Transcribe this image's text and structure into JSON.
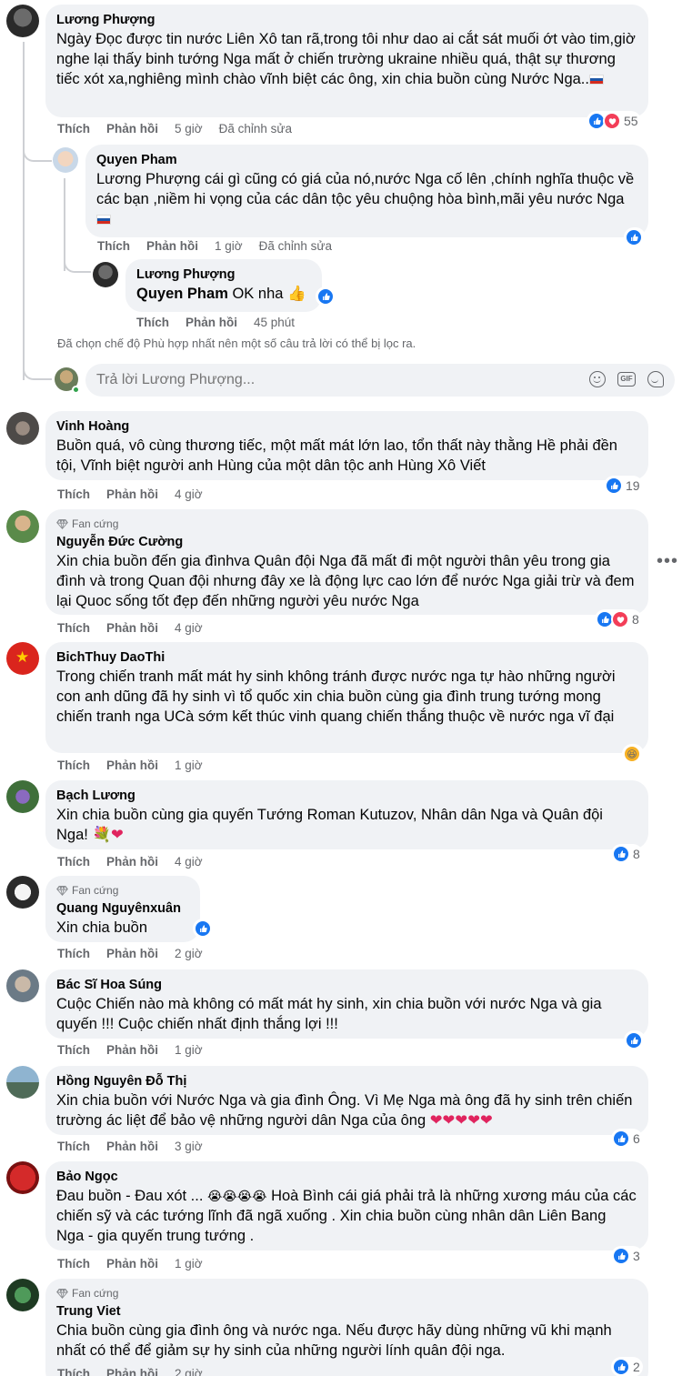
{
  "labels": {
    "like": "Thích",
    "reply": "Phản hồi",
    "edited": "Đã chỉnh sửa",
    "fan_badge": "Fan cứng"
  },
  "comments": [
    {
      "name": "Lương Phượng",
      "text": "Ngày Đọc được tin nước Liên Xô tan rã,trong tôi như dao ai cắt sát muối ớt vào tim,giờ nghe lại thấy binh tướng Nga mất ở chiến trường ukraine nhiều quá, thật sự thương tiếc xót xa,nghiêng mình chào vĩnh biệt các ông, xin chia buồn cùng Nước Nga..",
      "time": "5 giờ",
      "reactions": "55"
    },
    {
      "name": "Vinh Hoàng",
      "text": "Buồn quá, vô cùng thương tiếc, một mất mát lớn lao, tổn thất này thằng Hề phải đền tội, Vĩnh biệt người anh Hùng của một dân tộc anh Hùng Xô Viết",
      "time": "4 giờ",
      "reactions": "19"
    },
    {
      "name": "Nguyễn Đức Cường",
      "text": "Xin chia buồn đến gia đìnhva Quân đội Nga đã mất đi một người thân yêu trong gia đình và trong Quan đội nhưng đây xe là động lực cao lớn để nước Nga giải trừ và đem lại Quoc sống tốt đẹp đến những người yêu nước Nga",
      "time": "4 giờ",
      "reactions": "8"
    },
    {
      "name": "BichThuy DaoThi",
      "text": "Trong chiến tranh mất mát hy sinh không tránh được nước nga tự hào những người con anh dũng đã hy sinh vì tổ quốc xin chia buồn cùng gia đình trung tướng mong chiến tranh nga UCà sớm kết thúc vinh quang chiến thắng thuộc về nước nga vĩ đại",
      "time": "1 giờ"
    },
    {
      "name": "Bạch Lương",
      "text": "Xin chia buồn cùng gia quyến Tướng Roman Kutuzov, Nhân dân Nga và Quân đội Nga!",
      "time": "4 giờ",
      "reactions": "8"
    },
    {
      "name": "Quang Nguyênxuân",
      "text": "Xin chia buồn",
      "time": "2 giờ"
    },
    {
      "name": "Bác Sĩ Hoa Súng",
      "text": "Cuộc Chiến nào mà không có mất mát hy sinh, xin chia buồn với nước Nga và gia quyến !!! Cuộc chiến nhất định thắng lợi !!!",
      "time": "1 giờ"
    },
    {
      "name": "Hồng Nguyên Đỗ Thị",
      "text": "Xin chia buồn với Nước Nga và gia đình Ông. Vì Mẹ Nga mà ông đã hy sinh trên chiến trường ác liệt để bảo vệ những người dân Nga của ông",
      "time": "3 giờ",
      "reactions": "6"
    },
    {
      "name": "Bảo Ngọc",
      "text_a": "Đau buồn - Đau xót ...",
      "text_b": "Hoà Bình cái giá phải trả là những xương máu của các chiến sỹ và các tướng lĩnh đã ngã xuống . Xin chia buồn cùng nhân dân Liên Bang Nga - gia quyến trung tướng .",
      "time": "1 giờ",
      "reactions": "3"
    },
    {
      "name": "Trung Viet",
      "text": "Chia buồn cùng gia đình ông và nước nga. Nếu được hãy dùng những vũ khi mạnh nhất có thể để giảm sự hy sinh của những người lính quân đội nga.",
      "time": "2 giờ",
      "reactions": "2"
    }
  ],
  "replies": [
    {
      "name": "Quyen Pham",
      "text": "Lương Phượng cái gì cũng có giá của nó,nước Nga cố lên ,chính nghĩa thuộc về các bạn ,niềm hi vọng của các dân tộc yêu chuộng hòa bình,mãi yêu nước Nga",
      "time": "1 giờ"
    },
    {
      "name": "Lương Phượng",
      "mention": "Quyen Pham",
      "text": "OK nha",
      "time": "45 phút"
    }
  ],
  "filter_note": "Đã chọn chế độ Phù hợp nhất nên một số câu trả lời có thể bị lọc ra.",
  "reply_input": {
    "placeholder": "Trả lời Lương Phượng..."
  },
  "icons": {
    "like": "like-icon",
    "heart": "heart-icon",
    "haha": "haha-icon",
    "emoji": "emoji-icon",
    "gif": "gif-icon",
    "sticker": "sticker-icon",
    "more": "more-icon",
    "diamond": "diamond-icon"
  },
  "colors": {
    "like": "#1877f2",
    "heart": "#f33e58",
    "bubble": "#f0f2f5",
    "meta": "#65676b"
  }
}
